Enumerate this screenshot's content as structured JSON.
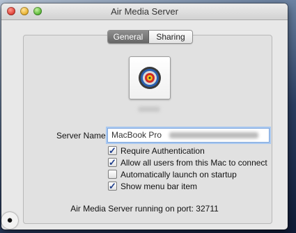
{
  "window": {
    "title": "Air Media Server"
  },
  "tabs": [
    {
      "label": "General",
      "selected": true
    },
    {
      "label": "Sharing",
      "selected": false
    }
  ],
  "app_icon": {
    "name": "target-icon"
  },
  "server_name": {
    "label": "Server Name:",
    "value": "MacBook Pro"
  },
  "options": [
    {
      "label": "Require Authentication",
      "checked": true,
      "mark": "✓"
    },
    {
      "label": "Allow all users from this Mac to connect",
      "checked": true,
      "mark": "✓"
    },
    {
      "label": "Automatically launch on startup",
      "checked": false,
      "mark": ""
    },
    {
      "label": "Show menu bar item",
      "checked": true,
      "mark": "✓"
    }
  ],
  "status": "Air Media Server running on port: 32711",
  "watermark": "",
  "colors": {
    "tab_selected": "#777777",
    "focus_ring": "#a9c8f0",
    "checkmark": "#1e3d8a"
  }
}
